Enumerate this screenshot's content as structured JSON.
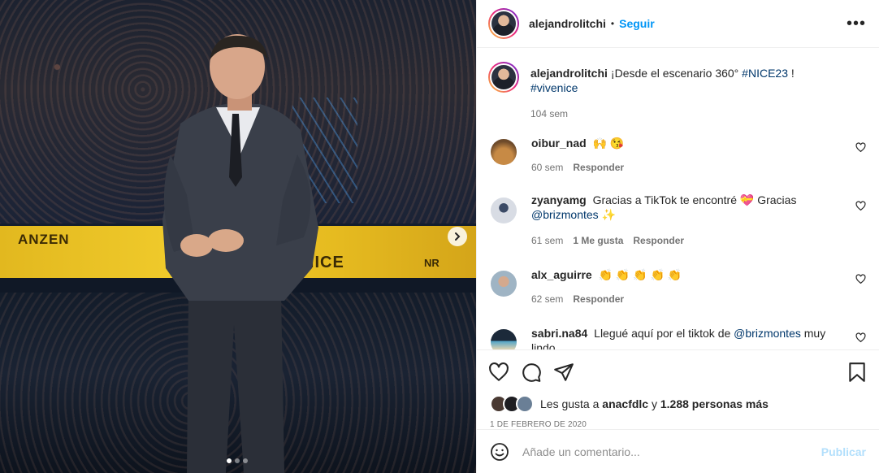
{
  "post": {
    "username": "alejandrolitchi",
    "separator": "•",
    "follow_label": "Seguir",
    "more_icon": "more-horizontal-icon"
  },
  "media": {
    "banner_left": "ANZEN",
    "banner_center": "NICE",
    "banner_right": "NR",
    "slide_current": 1,
    "slide_total": 3
  },
  "caption": {
    "username": "alejandrolitchi",
    "text_before": "¡Desde el escenario 360°",
    "hashtag1": "#NICE23",
    "text_between": "!",
    "hashtag2": "#vivenice",
    "time": "104 sem"
  },
  "comments": [
    {
      "username": "oibur_nad",
      "text": "🙌 😘",
      "time": "60 sem",
      "reply": "Responder"
    },
    {
      "username": "zyanyamg",
      "text": "Gracias a TikTok te encontré 💝  Gracias",
      "mention": "@brizmontes",
      "text_after": "✨",
      "time": "61 sem",
      "likes": "1 Me gusta",
      "reply": "Responder"
    },
    {
      "username": "alx_aguirre",
      "text": "👏 👏 👏 👏 👏",
      "time": "62 sem",
      "reply": "Responder"
    },
    {
      "username": "sabri.na84",
      "text": "Llegué aquí por el tiktok de",
      "mention": "@brizmontes",
      "text_after": "muy lindo"
    }
  ],
  "likes": {
    "prefix": "Les gusta a",
    "user": "anacfdlc",
    "conjunction": "y",
    "others": "1.288 personas más"
  },
  "date": "1 DE FEBRERO DE 2020",
  "add_comment": {
    "placeholder": "Añade un comentario...",
    "publish_label": "Publicar"
  },
  "colors": {
    "link": "#0095f6",
    "hashtag": "#00376b",
    "publish_disabled": "#b2dffc",
    "banner": "#f1cc2c"
  }
}
